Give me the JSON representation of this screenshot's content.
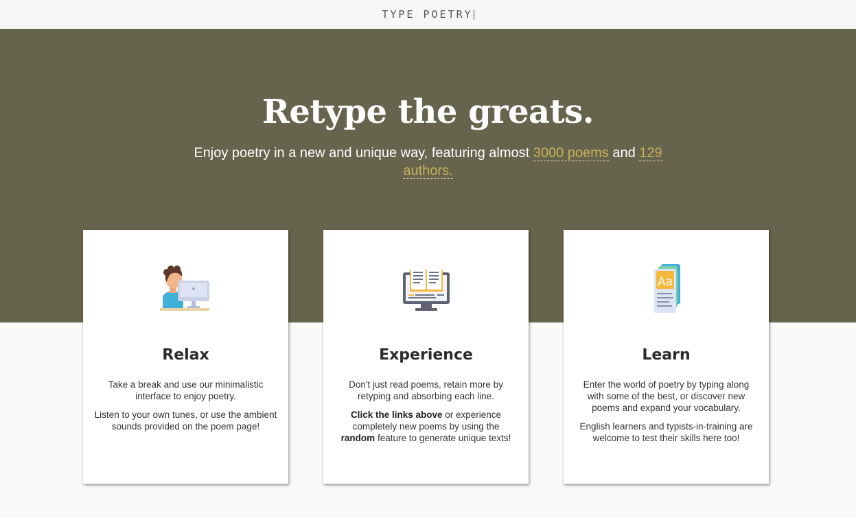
{
  "header": {
    "logo": "TYPE POETRY"
  },
  "hero": {
    "title": "Retype the greats.",
    "subtitle_prefix": "Enjoy poetry in a new and unique way, featuring almost ",
    "poems_link": "3000 poems",
    "subtitle_mid": " and ",
    "authors_link": "129 authors.",
    "bg_color": "#67644d",
    "link_color": "#c9b25a"
  },
  "cards": [
    {
      "icon": "person-at-computer-icon",
      "title": "Relax",
      "p1": "Take a break and use our minimalistic interface to enjoy poetry.",
      "p2": "Listen to your own tunes, or use the ambient sounds provided on the poem page!"
    },
    {
      "icon": "book-on-monitor-icon",
      "title": "Experience",
      "p1": "Don't just read poems, retain more by retyping and absorbing each line.",
      "p2_bold1": "Click the links above",
      "p2_text1": " or experience completely new poems by using the ",
      "p2_bold2": "random",
      "p2_text2": " feature to generate unique texts!"
    },
    {
      "icon": "dictionary-cards-icon",
      "title": "Learn",
      "p1": "Enter the world of poetry by typing along with some of the best, or discover new poems and expand your vocabulary.",
      "p2": "English learners and typists-in-training are welcome to test their skills here too!"
    }
  ]
}
